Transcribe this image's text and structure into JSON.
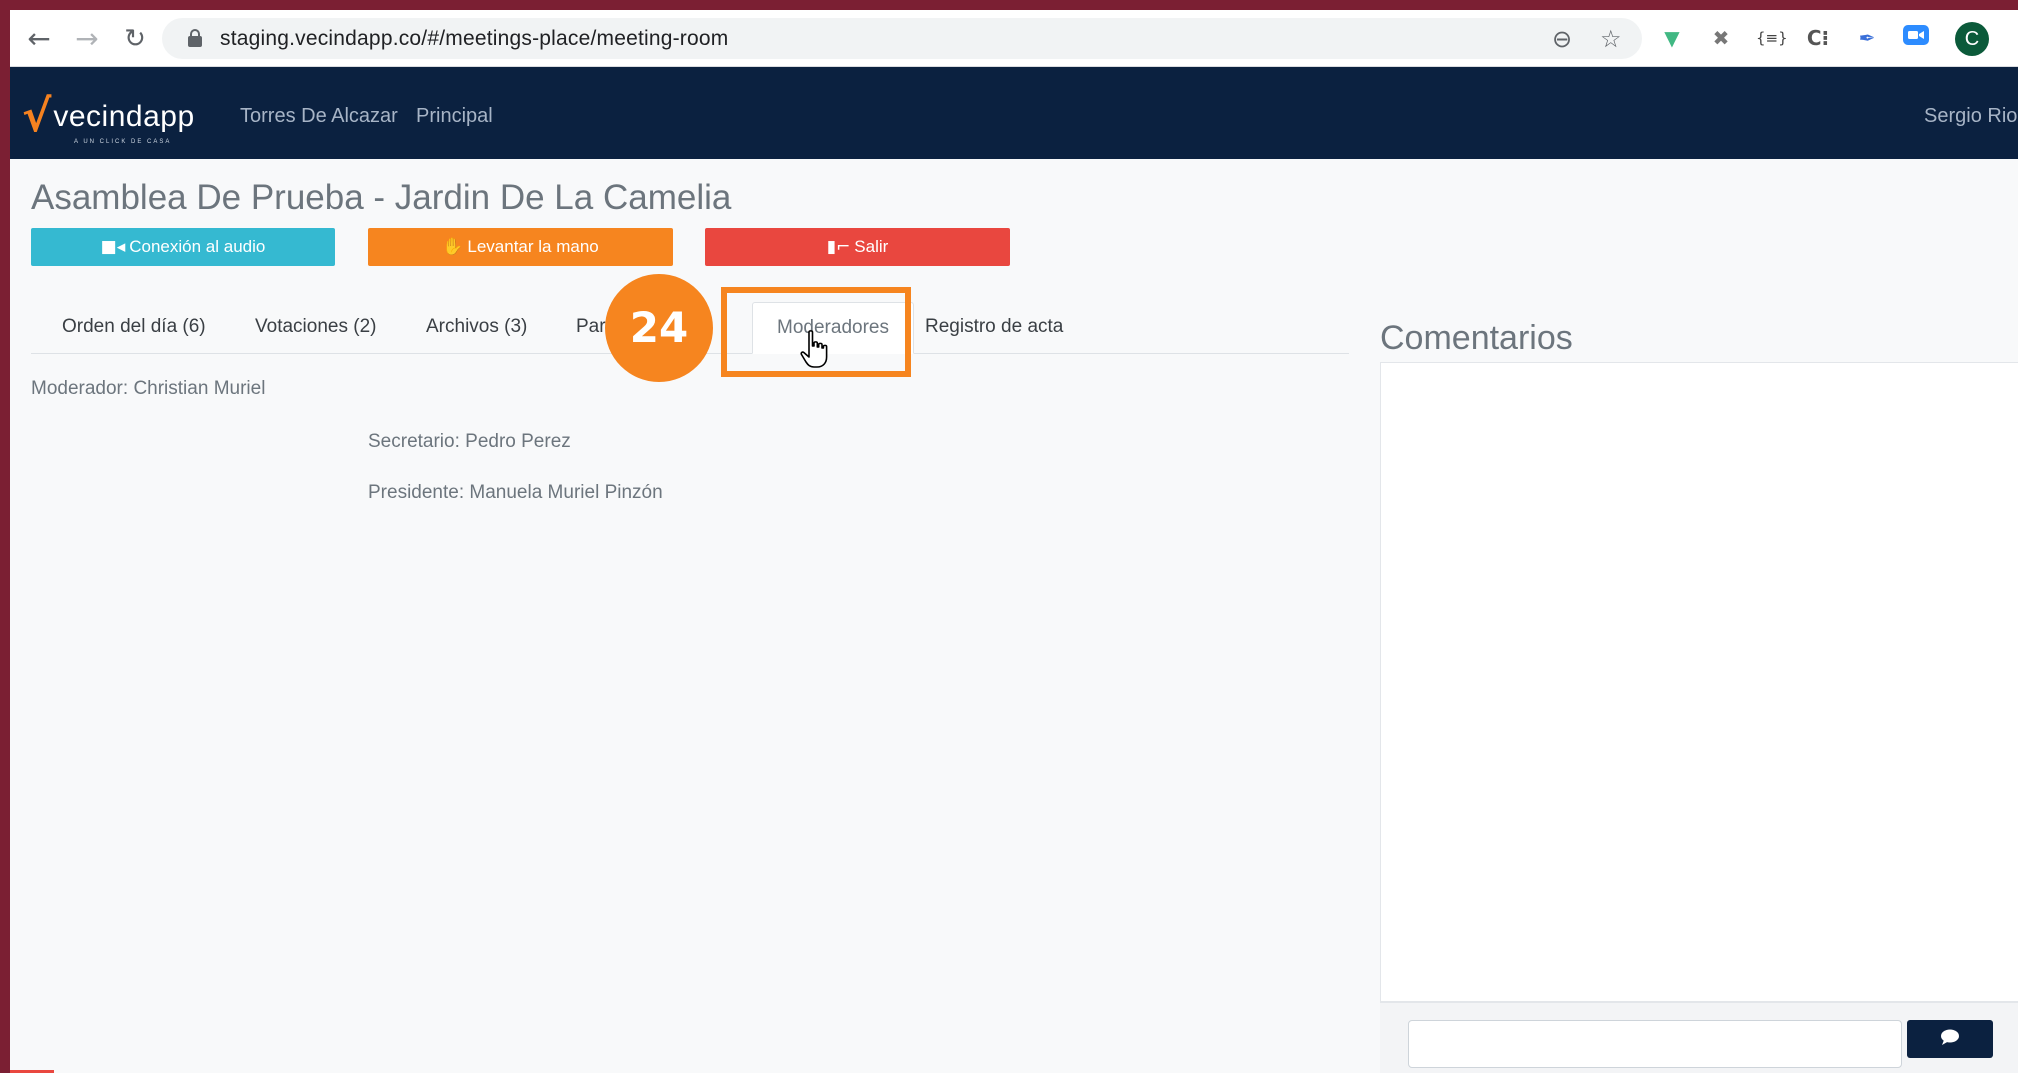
{
  "browser": {
    "url": "staging.vecindapp.co/#/meetings-place/meeting-room",
    "profile_initial": "C",
    "extensions": [
      "vue-devtools-icon",
      "extension-x-icon",
      "json-viewer-icon",
      "ci-extension-icon",
      "feather-extension-icon",
      "zoom-icon"
    ]
  },
  "navbar": {
    "logo": "vecindapp",
    "logo_tagline": "A UN CLICK DE CASA",
    "links": [
      "Torres De Alcazar",
      "Principal"
    ],
    "user": "Sergio Rios"
  },
  "meeting": {
    "title": "Asamblea De Prueba - Jardin De La Camelia",
    "buttons": {
      "audio": "Conexión al audio",
      "raise_hand": "Levantar la mano",
      "exit": "Salir"
    },
    "tabs": [
      "Orden del día (6)",
      "Votaciones (2)",
      "Archivos (3)",
      "Parti",
      "Moderadores",
      "Registro de acta"
    ],
    "active_tab": "Moderadores",
    "moderator": "Moderador: Christian Muriel",
    "secretary": "Secretario: Pedro Perez",
    "president": "Presidente: Manuela Muriel Pinzón"
  },
  "comments": {
    "title": "Comentarios",
    "input_value": ""
  },
  "tutorial": {
    "step": "24",
    "accent": "#f6851f"
  },
  "colors": {
    "navbar": "#0b2140",
    "audio_button": "#35b9d1",
    "hand_button": "#f6851f",
    "exit_button": "#e9473f"
  }
}
